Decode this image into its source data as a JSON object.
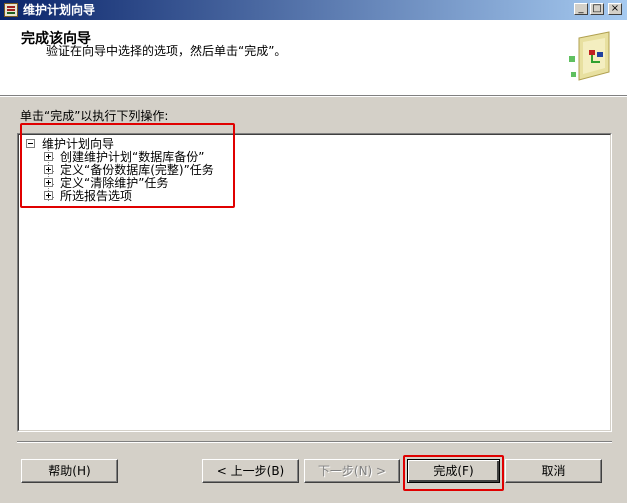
{
  "window": {
    "title": "维护计划向导",
    "controls": {
      "minimize": "_",
      "maximize": "□",
      "close": "×"
    }
  },
  "header": {
    "title": "完成该向导",
    "subtitle": "验证在向导中选择的选项，然后单击“完成”。",
    "image": "wizard-icon"
  },
  "instructions": "单击“完成”以执行下列操作:",
  "tree": {
    "root": {
      "label": "维护计划向导",
      "expanded": true
    },
    "children": [
      {
        "label": "创建维护计划“数据库备份”",
        "expanded": false
      },
      {
        "label": "定义“备份数据库(完整)”任务",
        "expanded": false
      },
      {
        "label": "定义“清除维护”任务",
        "expanded": false
      },
      {
        "label": "所选报告选项",
        "expanded": false
      }
    ]
  },
  "buttons": {
    "help": "帮助(H)",
    "back": "< 上一步(B)",
    "next": "下一步(N) >",
    "finish": "完成(F)",
    "cancel": "取消"
  },
  "colors": {
    "highlight": "#e00000",
    "titlebar_start": "#0a246a",
    "titlebar_end": "#a6caf0",
    "face": "#d4d0c8"
  }
}
